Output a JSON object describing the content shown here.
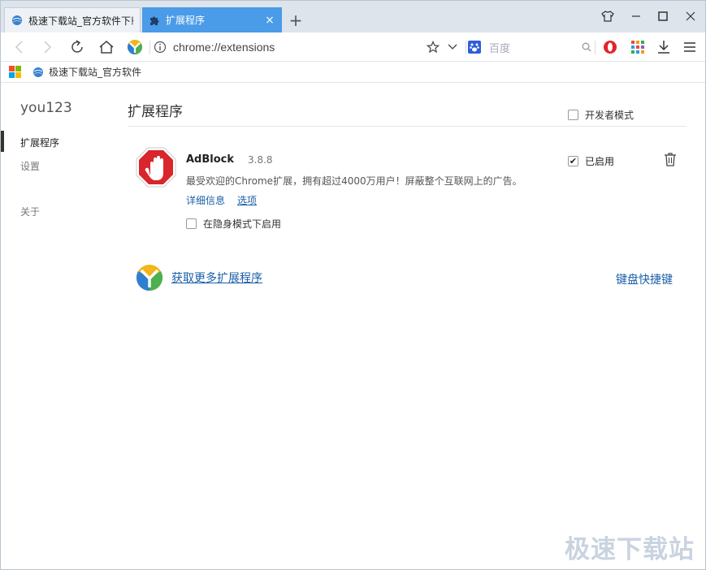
{
  "tabs": [
    {
      "title": "极速下载站_官方软件下载",
      "favicon": "globe-icon",
      "active": false
    },
    {
      "title": "扩展程序",
      "favicon": "puzzle-icon",
      "active": true,
      "close_label": "×"
    }
  ],
  "new_tab_label": "+",
  "window_controls": [
    "skin-icon",
    "minimize-icon",
    "maximize-icon",
    "close-icon"
  ],
  "toolbar": {
    "url": "chrome://extensions",
    "search_placeholder": "百度"
  },
  "bookmarks": {
    "items": [
      {
        "label": "极速下载站_官方软件"
      }
    ]
  },
  "sidebar": {
    "profile": "you123",
    "items": [
      {
        "label": "扩展程序",
        "selected": true
      },
      {
        "label": "设置",
        "selected": false
      },
      {
        "label": "关于",
        "selected": false
      }
    ]
  },
  "main": {
    "title": "扩展程序",
    "dev_mode_label": "开发者模式"
  },
  "extension": {
    "name": "AdBlock",
    "version": "3.8.8",
    "description": "最受欢迎的Chrome扩展，拥有超过4000万用户！屏蔽整个互联网上的广告。",
    "details_label": "详细信息",
    "options_label": "选项",
    "incognito_label": "在隐身模式下启用",
    "enabled_label": "已启用",
    "enabled_check": "✔"
  },
  "footer": {
    "get_more_label": "获取更多扩展程序",
    "shortcuts_label": "键盘快捷键"
  },
  "watermark": "极速下载站",
  "colors": {
    "accent": "#4a9be8",
    "link": "#1a5fa8",
    "adblock_red": "#d9252c"
  }
}
